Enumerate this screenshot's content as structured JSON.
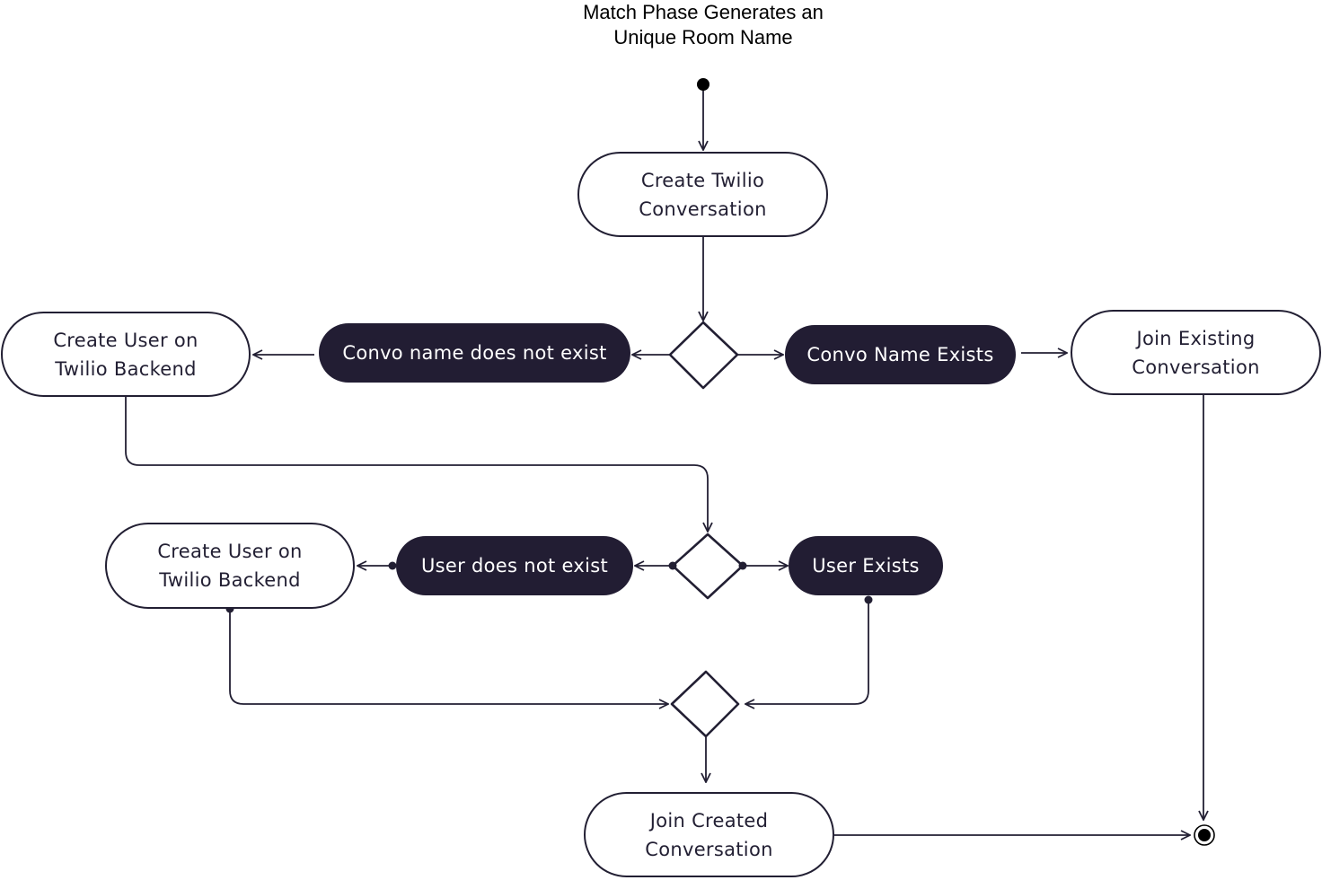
{
  "diagram": {
    "title": "Match Phase Generates an\nUnique Room Name",
    "nodes": {
      "create_convo": "Create Twilio\nConversation",
      "convo_not_exist": "Convo name does not exist",
      "convo_exists": "Convo Name Exists",
      "create_user_1": "Create User on\nTwilio Backend",
      "join_existing": "Join Existing\nConversation",
      "create_user_2": "Create User on\nTwilio Backend",
      "user_not_exist": "User does not exist",
      "user_exists": "User Exists",
      "join_created": "Join Created\nConversation"
    },
    "colors": {
      "stroke": "#221f33",
      "filled_node": "#221d33",
      "filled_text": "#ffffff"
    }
  }
}
